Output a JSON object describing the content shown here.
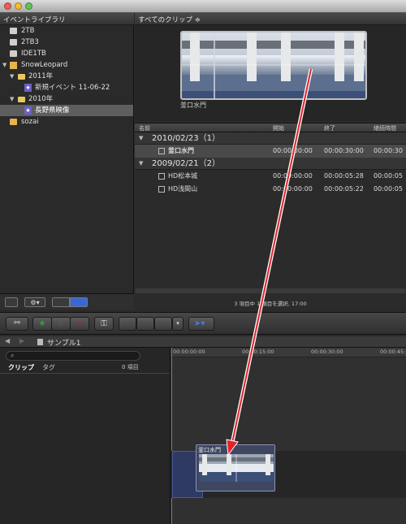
{
  "library": {
    "header": "イベントライブラリ",
    "items": [
      {
        "label": "2TB",
        "icon": "drive-icon"
      },
      {
        "label": "2TB3",
        "icon": "drive-icon"
      },
      {
        "label": "IDE1TB",
        "icon": "drive-icon"
      },
      {
        "label": "SnowLeopard",
        "icon": "home-drive-icon"
      },
      {
        "label": "2011年",
        "icon": "folder-icon"
      },
      {
        "label": "新規イベント 11-06-22",
        "icon": "event-star-icon"
      },
      {
        "label": "2010年",
        "icon": "folder-icon"
      },
      {
        "label": "長野県映像",
        "icon": "event-star-icon"
      },
      {
        "label": "sozai",
        "icon": "drive-icon"
      }
    ]
  },
  "browser": {
    "header": "すべてのクリップ ≑",
    "filmstrip_label": "釜口水門",
    "columns": {
      "name": "名前",
      "start": "開始",
      "end": "終了",
      "duration": "継続時間"
    },
    "groups": [
      {
        "label": "2010/02/23（1）",
        "clips": [
          {
            "name": "釜口水門",
            "start": "00:00:00:00",
            "end": "00:00:30:00",
            "duration": "00:00:30"
          }
        ]
      },
      {
        "label": "2009/02/21（2）",
        "clips": [
          {
            "name": "HD松本城",
            "start": "00:00:00:00",
            "end": "00:00:05:28",
            "duration": "00:00:05"
          },
          {
            "name": "HD浅間山",
            "start": "00:00:00:00",
            "end": "00:00:05:22",
            "duration": "00:00:05"
          }
        ]
      }
    ],
    "status": "3 項目中 1 項目を選択, 17:00"
  },
  "timeline": {
    "project_name": "サンプル1",
    "tabs": {
      "clips": "クリップ",
      "tags": "タグ"
    },
    "count": "0 項目",
    "ruler": [
      "00:00:00:00",
      "00:00:15:00",
      "00:00:30:00",
      "00:00:45:"
    ],
    "drag_clip_label": "釜口水門"
  },
  "colors": {
    "accent_blue": "#4a78d8",
    "arrow_red": "#e0242c",
    "selection_gray": "#5e5e5e"
  }
}
